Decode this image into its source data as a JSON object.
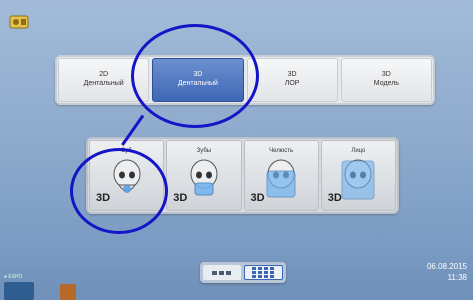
{
  "modes": [
    {
      "line1": "2D",
      "line2": "Дентальный",
      "active": false
    },
    {
      "line1": "3D",
      "line2": "Дентальный",
      "active": true
    },
    {
      "line1": "3D",
      "line2": "ЛОР",
      "active": false
    },
    {
      "line1": "3D",
      "line2": "Модель",
      "active": false
    }
  ],
  "submodes": [
    {
      "label": "Зуб",
      "tag": "3D",
      "icon": "skull-tooth-icon"
    },
    {
      "label": "Зубы",
      "tag": "3D",
      "icon": "skull-teeth-icon"
    },
    {
      "label": "Челюсть",
      "tag": "3D",
      "icon": "skull-jaw-icon"
    },
    {
      "label": "Лицо",
      "tag": "3D",
      "icon": "skull-face-icon"
    }
  ],
  "datetime": {
    "date": "06.08.2015",
    "time": "11:38"
  },
  "status": {
    "label": "EXPO"
  },
  "colors": {
    "accent": "#3f67b4",
    "annotation": "#1515c8"
  }
}
